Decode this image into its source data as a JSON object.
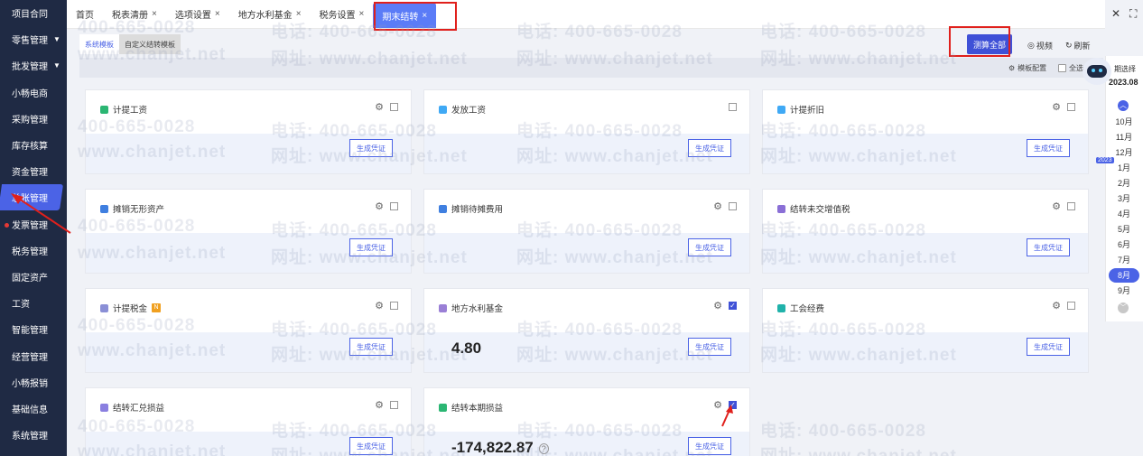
{
  "sidebar": {
    "items": [
      {
        "label": "项目合同",
        "caret": false
      },
      {
        "label": "零售管理",
        "caret": true
      },
      {
        "label": "批发管理",
        "caret": true
      },
      {
        "label": "小畅电商",
        "caret": false
      },
      {
        "label": "采购管理",
        "caret": false
      },
      {
        "label": "库存核算",
        "caret": false
      },
      {
        "label": "资金管理",
        "caret": false
      },
      {
        "label": "总账管理",
        "caret": false,
        "active": true
      },
      {
        "label": "发票管理",
        "caret": false,
        "dot": true
      },
      {
        "label": "税务管理",
        "caret": false
      },
      {
        "label": "固定资产",
        "caret": false
      },
      {
        "label": "工资",
        "caret": false
      },
      {
        "label": "智能管理",
        "caret": false
      },
      {
        "label": "经营管理",
        "caret": false
      },
      {
        "label": "小畅报销",
        "caret": false
      },
      {
        "label": "基础信息",
        "caret": false
      },
      {
        "label": "系统管理",
        "caret": false
      }
    ]
  },
  "tabs": [
    {
      "label": "首页",
      "closable": false
    },
    {
      "label": "税表清册",
      "closable": true
    },
    {
      "label": "选项设置",
      "closable": true
    },
    {
      "label": "地方水利基金",
      "closable": true
    },
    {
      "label": "税务设置",
      "closable": true
    },
    {
      "label": "期末结转",
      "closable": true,
      "active": true
    }
  ],
  "close_glyph": "×",
  "subtabs": {
    "system": "系统模板",
    "custom": "自定义结转模板"
  },
  "header": {
    "calc_all": "测算全部",
    "video": "视频",
    "refresh": "刷新"
  },
  "toolbar": {
    "template_config": "模板配置",
    "select_all": "全选"
  },
  "cards": [
    {
      "title": "计提工资",
      "icon_color": "#2bb673",
      "gear": true,
      "checked": false,
      "button": "生成凭证",
      "amount": ""
    },
    {
      "title": "发放工资",
      "icon_color": "#3fa9f5",
      "gear": false,
      "checked": false,
      "button": "生成凭证",
      "amount": ""
    },
    {
      "title": "计提折旧",
      "icon_color": "#3fa9f5",
      "gear": true,
      "checked": false,
      "button": "生成凭证",
      "amount": ""
    },
    {
      "title": "摊销无形资产",
      "icon_color": "#3f7fe0",
      "gear": true,
      "checked": false,
      "button": "生成凭证",
      "amount": ""
    },
    {
      "title": "摊销待摊费用",
      "icon_color": "#3f7fe0",
      "gear": true,
      "checked": false,
      "button": "生成凭证",
      "amount": ""
    },
    {
      "title": "结转未交增值税",
      "icon_color": "#8a6fd6",
      "gear": true,
      "checked": false,
      "button": "生成凭证",
      "amount": ""
    },
    {
      "title": "计提税金",
      "icon_color": "#8a8fd6",
      "gear": true,
      "checked": false,
      "button": "生成凭证",
      "amount": "",
      "badge": "N"
    },
    {
      "title": "地方水利基金",
      "icon_color": "#9a7fd6",
      "gear": true,
      "checked": true,
      "button": "生成凭证",
      "amount": "4.80"
    },
    {
      "title": "工会经费",
      "icon_color": "#20b2aa",
      "gear": true,
      "checked": false,
      "button": "生成凭证",
      "amount": ""
    },
    {
      "title": "结转汇兑损益",
      "icon_color": "#8a7fe0",
      "gear": true,
      "checked": false,
      "button": "生成凭证",
      "amount": ""
    },
    {
      "title": "结转本期损益",
      "icon_color": "#2bb673",
      "gear": true,
      "checked": true,
      "button": "生成凭证",
      "amount": "-174,822.87",
      "help": "?"
    }
  ],
  "month_panel": {
    "label": "期间选择",
    "label_partial": "期选择",
    "current": "2023.08",
    "months_prev_year": [
      "10月",
      "11月",
      "12月"
    ],
    "year_badge": "2023",
    "months": [
      "1月",
      "2月",
      "3月",
      "4月",
      "5月",
      "6月",
      "7月",
      "8月",
      "9月"
    ],
    "selected": "8月"
  },
  "watermark": {
    "phone": "电话: 400-665-0028",
    "site": "网址: www.chanjet.net",
    "phone_part": "400-665-0028",
    "site_part": "www.chanjet.net"
  }
}
